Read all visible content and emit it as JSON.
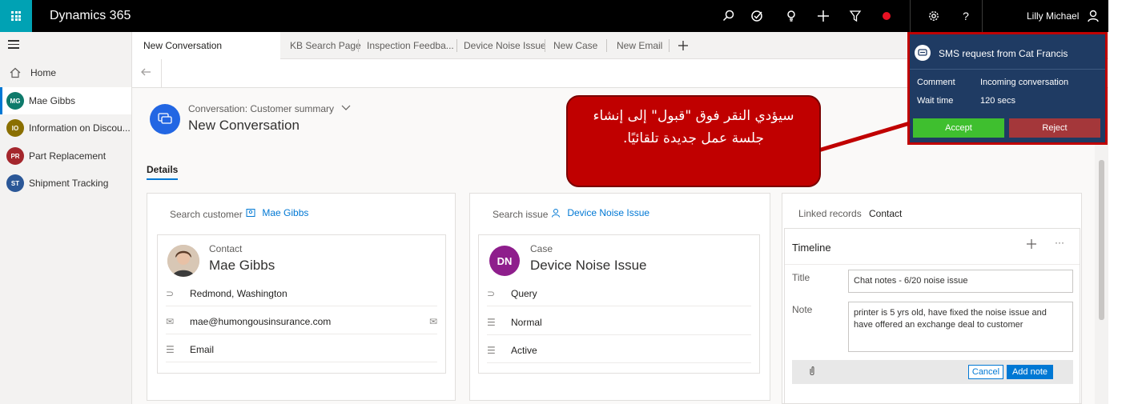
{
  "topbar": {
    "app_title": "Dynamics 365",
    "user_name": "Lilly Michael",
    "help_label": "?"
  },
  "leftnav": {
    "items": [
      {
        "label": "Home"
      },
      {
        "label": "Mae Gibbs",
        "initials": "MG",
        "color": "#0e7a6b"
      },
      {
        "label": "Information on Discou...",
        "initials": "IO",
        "color": "#8a6f00"
      },
      {
        "label": "Part Replacement",
        "initials": "PR",
        "color": "#a4262c"
      },
      {
        "label": "Shipment Tracking",
        "initials": "ST",
        "color": "#2b5797"
      }
    ]
  },
  "tabs": [
    {
      "label": "New Conversation"
    },
    {
      "label": "KB Search Page"
    },
    {
      "label": "Inspection Feedba..."
    },
    {
      "label": "Device Noise Issue"
    },
    {
      "label": "New Case"
    },
    {
      "label": "New Email"
    }
  ],
  "conversation": {
    "subtitle": "Conversation: Customer summary",
    "title": "New Conversation",
    "details_tab": "Details"
  },
  "customer_panel": {
    "search_label": "Search customer",
    "search_value": "Mae Gibbs",
    "card_type": "Contact",
    "card_name": "Mae Gibbs",
    "fields": [
      "Redmond, Washington",
      "mae@humongousinsurance.com",
      "Email"
    ]
  },
  "issue_panel": {
    "search_label": "Search issue",
    "search_value": "Device Noise Issue",
    "card_type": "Case",
    "card_initials": "DN",
    "card_color": "#8e1e8c",
    "card_name": "Device Noise Issue",
    "fields": [
      "Query",
      "Normal",
      "Active"
    ]
  },
  "timeline_panel": {
    "linked_label": "Linked records",
    "linked_value": "Contact",
    "title": "Timeline",
    "title_label": "Title",
    "title_value": "Chat notes - 6/20 noise issue",
    "note_label": "Note",
    "note_value": "printer is 5 yrs old, have fixed the noise issue and have offered an exchange deal to customer",
    "cancel_label": "Cancel",
    "add_label": "Add note"
  },
  "sms": {
    "title": "SMS request from Cat Francis",
    "comment_label": "Comment",
    "comment_value": "Incoming conversation",
    "wait_label": "Wait time",
    "wait_value": "120 secs",
    "accept_label": "Accept",
    "reject_label": "Reject"
  },
  "callout": {
    "text": "سيؤدي النقر فوق \"قبول\" إلى إنشاء جلسة عمل جديدة تلقائيًا."
  },
  "colors": {
    "accent": "#0078d4",
    "callout": "#c00000",
    "sms_bg": "#1f3b63"
  }
}
